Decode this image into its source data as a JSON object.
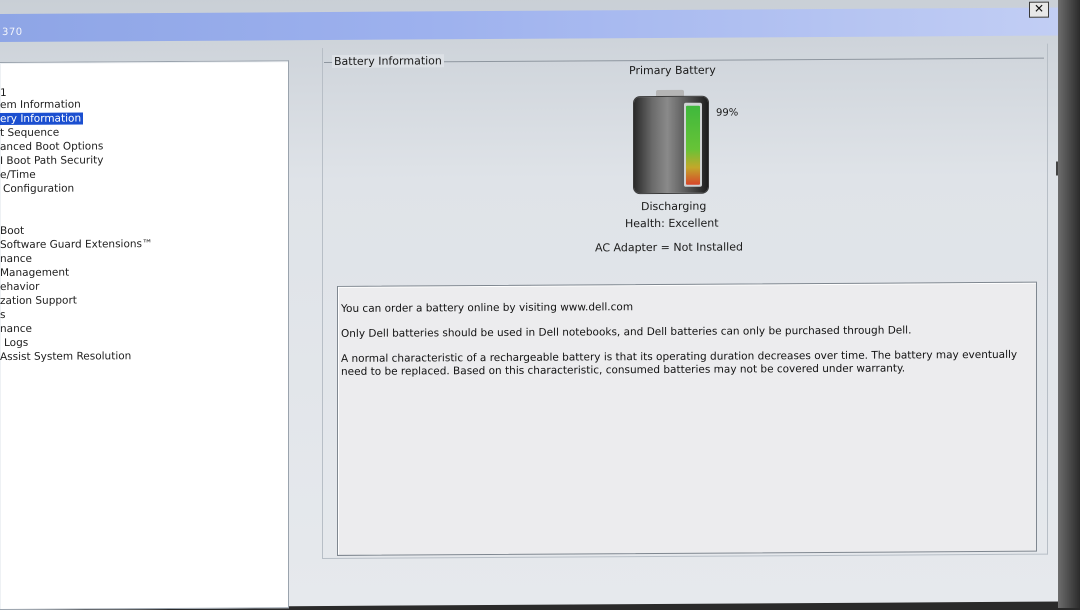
{
  "window": {
    "title_fragment": "370",
    "close_label": "✕"
  },
  "nav": {
    "items": [
      {
        "label": "1",
        "selected": false
      },
      {
        "label": "em Information",
        "selected": false
      },
      {
        "label": "ery Information",
        "selected": true
      },
      {
        "label": "t Sequence",
        "selected": false
      },
      {
        "label": "anced Boot Options",
        "selected": false
      },
      {
        "label": "I Boot Path Security",
        "selected": false
      },
      {
        "label": "e/Time",
        "selected": false
      },
      {
        "label": "Configuration",
        "selected": false
      },
      {
        "label": "Boot",
        "selected": false
      },
      {
        "label": "Software Guard Extensions™",
        "selected": false
      },
      {
        "label": "nance",
        "selected": false
      },
      {
        "label": "Management",
        "selected": false
      },
      {
        "label": "ehavior",
        "selected": false
      },
      {
        "label": "zation Support",
        "selected": false
      },
      {
        "label": "s",
        "selected": false
      },
      {
        "label": "nance",
        "selected": false
      },
      {
        "label": "Logs",
        "selected": false
      },
      {
        "label": "Assist System Resolution",
        "selected": false
      }
    ]
  },
  "battery": {
    "group_label": "Battery Information",
    "title": "Primary Battery",
    "percent_text": "99%",
    "charge_level": 0.99,
    "status": "Discharging",
    "health": "Health: Excellent",
    "ac_adapter": "AC Adapter = Not Installed",
    "colors": {
      "fill_top": "#3fb83d",
      "fill_bottom": "#d7462a",
      "selected_nav": "#1b4fd0"
    }
  },
  "info": {
    "line1": "You can order a battery online by visiting www.dell.com",
    "line2": "Only Dell batteries should be used in Dell notebooks, and Dell batteries can only be purchased through Dell.",
    "line3": "A normal characteristic of a rechargeable battery is that its operating duration decreases over time.  The battery may eventually need to be replaced.  Based on this characteristic, consumed batteries may not be covered under warranty."
  }
}
